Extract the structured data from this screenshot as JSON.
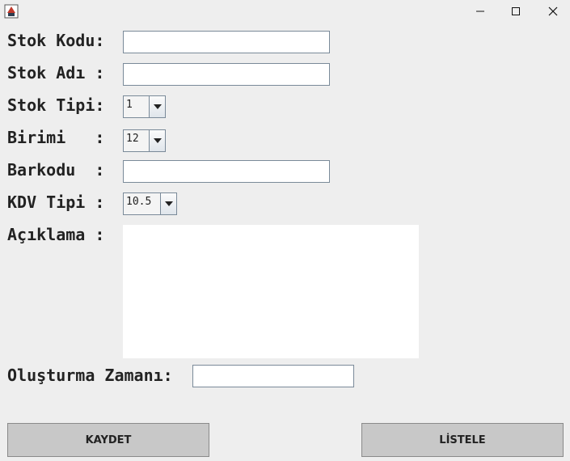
{
  "window": {
    "app_icon": "java-cup-icon",
    "controls": {
      "minimize": "minimize-icon",
      "maximize": "maximize-icon",
      "close": "close-icon"
    }
  },
  "form": {
    "stok_kodu": {
      "label": "Stok Kodu:",
      "value": ""
    },
    "stok_adi": {
      "label": "Stok Adı :",
      "value": ""
    },
    "stok_tipi": {
      "label": "Stok Tipi:",
      "value": "1"
    },
    "birimi": {
      "label": "Birimi   :",
      "value": "12"
    },
    "barkodu": {
      "label": "Barkodu  :",
      "value": ""
    },
    "kdv_tipi": {
      "label": "KDV Tipi :",
      "value": "10.5"
    },
    "aciklama": {
      "label": "Açıklama :",
      "value": ""
    },
    "olusturma_zamani": {
      "label": "Oluşturma Zamanı:",
      "value": ""
    }
  },
  "buttons": {
    "kaydet": "KAYDET",
    "listele": "LİSTELE"
  },
  "colors": {
    "background": "#eeeeee",
    "button": "#c8c8c8",
    "border": "#7a8a99"
  }
}
